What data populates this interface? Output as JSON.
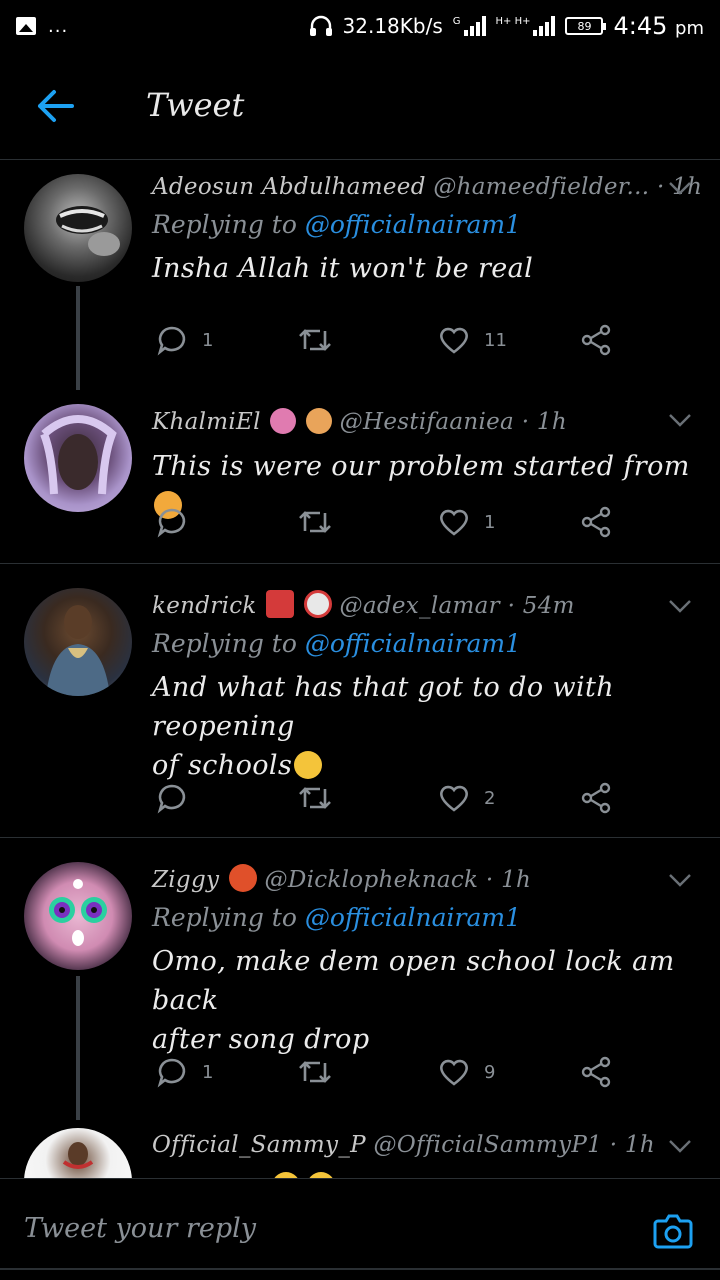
{
  "status_bar": {
    "left_dots": "...",
    "speed": "32.18Kb/s",
    "net1": "G",
    "net2": "H+ H+",
    "battery": "89",
    "time": "4:45",
    "ampm": "pm"
  },
  "header": {
    "title": "Tweet"
  },
  "tweets": [
    {
      "name": "Adeosun Abdulhameed",
      "handle": "@hameedfielder...",
      "time": "· 1h",
      "replying_label": "Replying to",
      "replying_handle": "@officialnairam1",
      "text": "Insha Allah it won't be real",
      "replies": "1",
      "likes": "11"
    },
    {
      "name": "KhalmiEl",
      "handle": "@Hestifaaniea",
      "time": "· 1h",
      "text": "This is were our problem started from",
      "replies": "",
      "likes": "1"
    },
    {
      "name": "kendrick",
      "handle": "@adex_lamar",
      "time": "· 54m",
      "replying_label": "Replying to",
      "replying_handle": "@officialnairam1",
      "text_line1": "And what has that got to do with reopening",
      "text_line2": "of schools",
      "replies": "",
      "likes": "2"
    },
    {
      "name": "Ziggy",
      "handle": "@Dicklopheknack",
      "time": "· 1h",
      "replying_label": "Replying to",
      "replying_handle": "@officialnairam1",
      "text_line1": "Omo, make dem open school lock am back",
      "text_line2": "after song drop",
      "replies": "1",
      "likes": "9"
    },
    {
      "name": "Official_Sammy_P",
      "handle": "@OfficialSammyP1",
      "time": "· 1h"
    }
  ],
  "reply_bar": {
    "placeholder": "Tweet your reply"
  },
  "colors": {
    "accent": "#1DA1F2",
    "mention": "#2a8fe0",
    "muted": "#8a9096",
    "divider": "#2a2f33"
  }
}
